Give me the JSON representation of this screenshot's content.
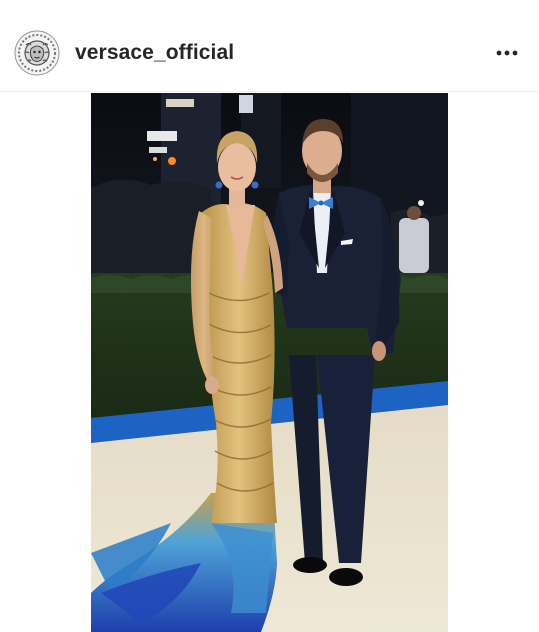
{
  "post": {
    "username": "versace_official",
    "avatar_icon": "versace-medusa-logo-icon",
    "more_icon": "more-options-icon",
    "photo_description": "couple-on-red-carpet-photo"
  },
  "colors": {
    "text": "#262626",
    "divider": "#efefef",
    "background": "#ffffff"
  }
}
